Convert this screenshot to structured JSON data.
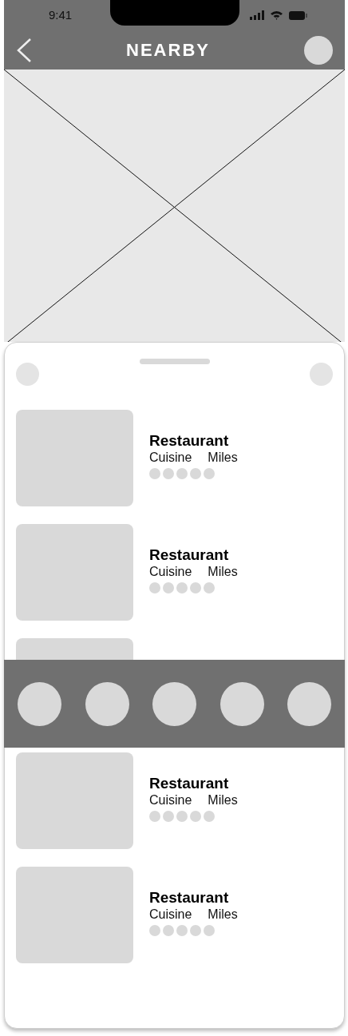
{
  "status_bar": {
    "time": "9:41"
  },
  "nav": {
    "title": "NEARBY"
  },
  "restaurants": [
    {
      "kind": "full",
      "name": "Restaurant",
      "cuisine": "Cuisine",
      "distance": "Miles"
    },
    {
      "kind": "full",
      "name": "Restaurant",
      "cuisine": "Cuisine",
      "distance": "Miles"
    },
    {
      "kind": "partial"
    },
    {
      "kind": "full",
      "name": "Restaurant",
      "cuisine": "Cuisine",
      "distance": "Miles"
    },
    {
      "kind": "full",
      "name": "Restaurant",
      "cuisine": "Cuisine",
      "distance": "Miles"
    }
  ],
  "category_bar": {
    "items": [
      {
        "kind": "circle"
      },
      {
        "kind": "circle"
      },
      {
        "kind": "circle"
      },
      {
        "kind": "circle"
      },
      {
        "kind": "circle"
      }
    ]
  }
}
